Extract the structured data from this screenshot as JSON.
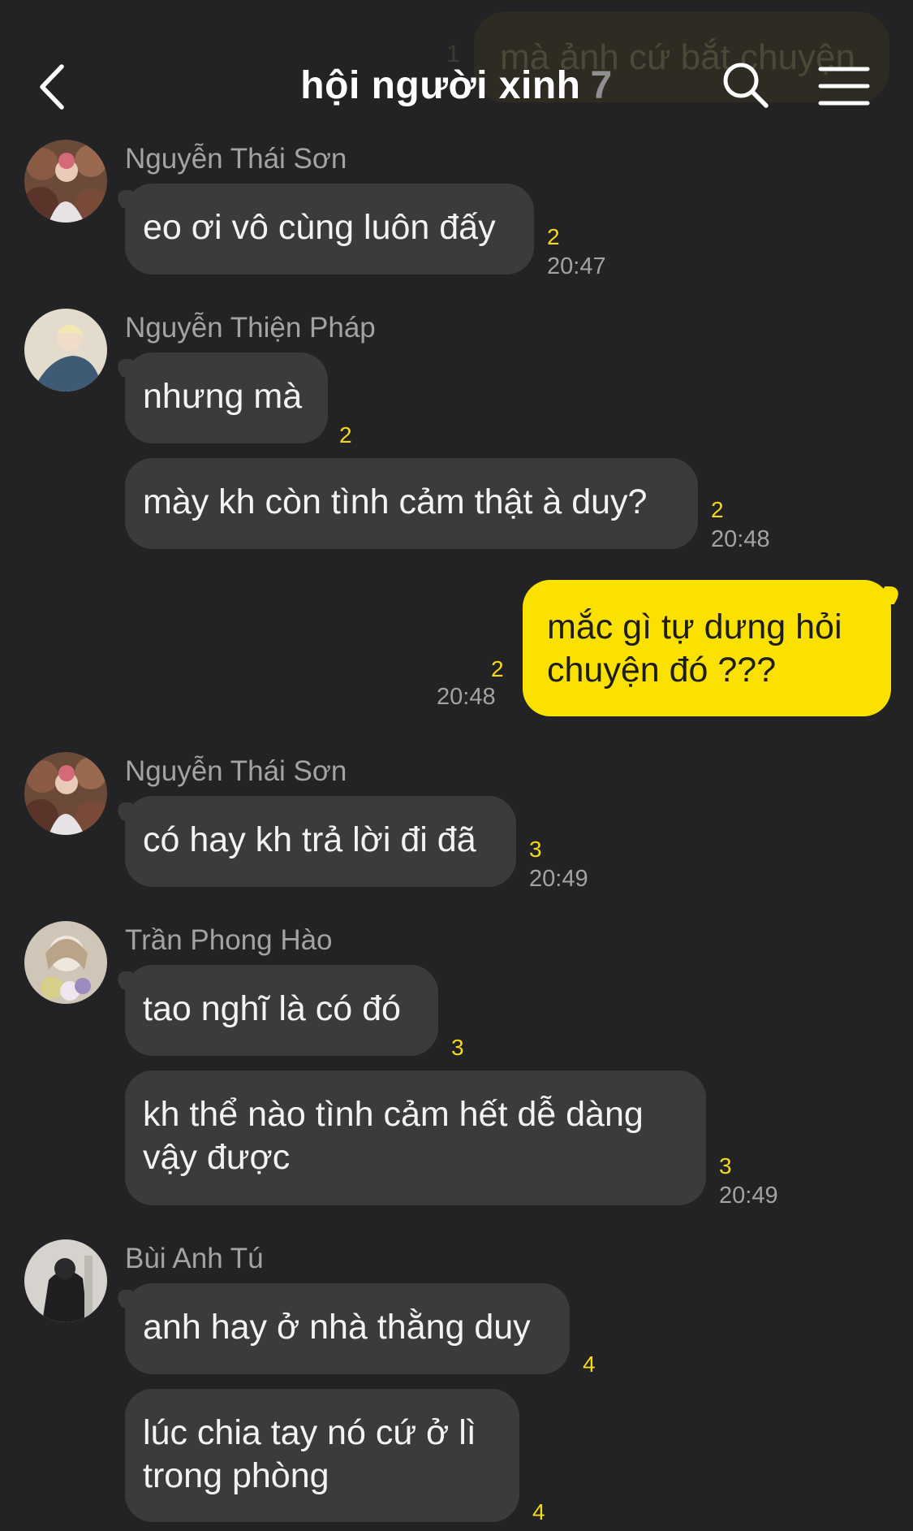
{
  "header": {
    "title": "hội người xinh",
    "member_count": "7",
    "preview_text": "mà ảnh cứ bắt chuyện",
    "preview_count": "1",
    "back_icon": "chevron-left-icon",
    "search_icon": "search-icon",
    "menu_icon": "hamburger-menu-icon"
  },
  "messages": [
    {
      "sender": "Nguyễn Thái Sơn",
      "text": "eo ơi vô cùng luôn đấy",
      "unread": "2",
      "time": "20:47"
    },
    {
      "sender": "Nguyễn Thiện Pháp",
      "text": "nhưng mà",
      "unread": "2",
      "time": ""
    },
    {
      "sender": "",
      "text": "mày kh còn tình cảm thật à duy?",
      "unread": "2",
      "time": "20:48"
    },
    {
      "sender": "me",
      "text_line1": "mắc gì tự dưng hỏi",
      "text_line2": "chuyện đó ???",
      "unread": "2",
      "time": "20:48"
    },
    {
      "sender": "Nguyễn Thái Sơn",
      "text": "có hay kh trả lời đi đã",
      "unread": "3",
      "time": "20:49"
    },
    {
      "sender": "Trần Phong Hào",
      "text": "tao nghĩ là có đó",
      "unread": "3",
      "time": ""
    },
    {
      "sender": "",
      "text_line1": "kh thể nào tình cảm hết dễ dàng",
      "text_line2": "vậy được",
      "unread": "3",
      "time": "20:49"
    },
    {
      "sender": "Bùi Anh Tú",
      "text": "anh hay ở nhà thằng duy",
      "unread": "4",
      "time": ""
    },
    {
      "sender": "",
      "text_line1": "lúc chia tay nó cứ ở lì",
      "text_line2": "trong phòng",
      "unread": "4",
      "time": ""
    }
  ],
  "colors": {
    "background": "#232325",
    "incoming_bubble": "#3b3b3d",
    "outgoing_bubble": "#fae100",
    "unread_count": "#f4d81a"
  }
}
